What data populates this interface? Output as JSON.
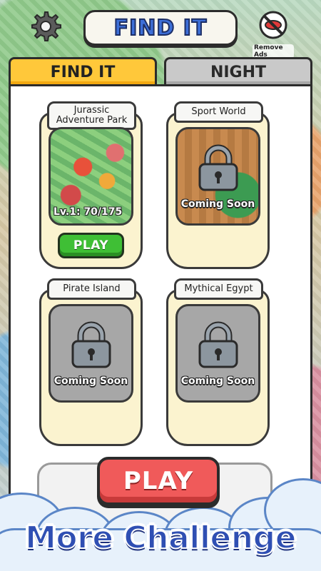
{
  "header": {
    "title": "FIND IT",
    "remove_ads_label": "Remove Ads",
    "settings_icon": "gear-icon",
    "remove_ads_icon": "no-ads-icon"
  },
  "tabs": [
    {
      "label": "FIND IT",
      "active": true
    },
    {
      "label": "NIGHT",
      "active": false
    }
  ],
  "levels": [
    {
      "title": "Jurassic Adventure Park",
      "progress_text": "Lv.1: 70/175",
      "play_label": "PLAY",
      "locked": false
    },
    {
      "title": "Sport World",
      "status": "Coming Soon",
      "locked": true
    },
    {
      "title": "Pirate Island",
      "status": "Coming Soon",
      "locked": true
    },
    {
      "title": "Mythical Egypt",
      "status": "Coming Soon",
      "locked": true
    }
  ],
  "promo": {
    "play_label": "PLAY",
    "banner_text": "More Challenge"
  },
  "colors": {
    "tab_active": "#ffc83a",
    "tab_inactive": "#c9c9c9",
    "play_green": "#3fbf35",
    "play_red": "#f05a5a",
    "title_blue": "#3d6fd8"
  }
}
